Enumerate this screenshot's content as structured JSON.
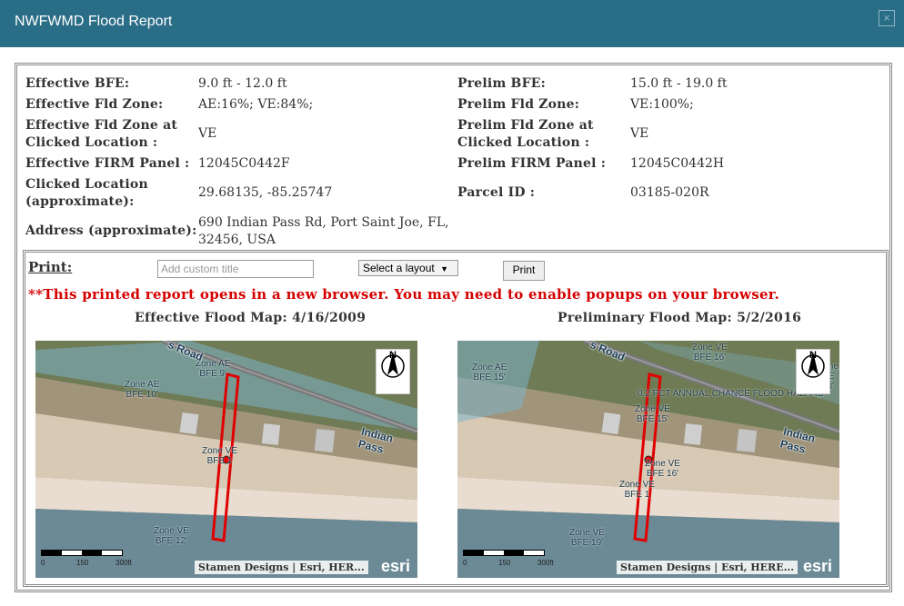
{
  "window": {
    "title": "NWFWMD Flood Report",
    "close_glyph": "×"
  },
  "effective": {
    "bfe_label": "Effective BFE:",
    "bfe": "9.0  ft  -  12.0  ft",
    "zone_label": "Effective Fld Zone:",
    "zone": "AE:16%;  VE:84%;",
    "clicked_zone_label_1": "Effective Fld Zone at",
    "clicked_zone_label_2": "Clicked Location :",
    "clicked_zone": "VE",
    "panel_label": "Effective FIRM Panel :",
    "panel": "12045C0442F"
  },
  "prelim": {
    "bfe_label": "Prelim BFE:",
    "bfe": "15.0  ft  -  19.0  ft",
    "zone_label": "Prelim Fld Zone:",
    "zone": "VE:100%;",
    "clicked_zone_label_1": "Prelim Fld Zone at",
    "clicked_zone_label_2": "Clicked Location :",
    "clicked_zone": "VE",
    "panel_label": "Prelim FIRM Panel :",
    "panel": "12045C0442H"
  },
  "location": {
    "clicked_label_1": "Clicked Location",
    "clicked_label_2": "(approximate):",
    "clicked": "29.68135,  -85.25747",
    "parcel_label": "Parcel ID :",
    "parcel": "03185-020R",
    "address_label": "Address (approximate):",
    "address_1": "690  Indian  Pass  Rd,  Port  Saint  Joe,  FL,",
    "address_2": "32456,  USA"
  },
  "print": {
    "label": "Print:",
    "title_placeholder": "Add custom title",
    "layout_label": "Select a layout",
    "layout_arrow": "▼",
    "button": "Print",
    "warning": "**This printed report opens in a new browser. You may need to enable popups on your browser."
  },
  "maps": [
    {
      "title": "Effective Flood Map: 4/16/2009",
      "road": "s Road",
      "road2": "Indian Pass",
      "zones": [
        {
          "l1": "Zone AE",
          "l2": "BFE 9'"
        },
        {
          "l1": "Zone AE",
          "l2": "BFE 10'"
        },
        {
          "l1": "Zone VE",
          "l2": "BFE 1"
        },
        {
          "l1": "Zone VE",
          "l2": "BFE 12'"
        }
      ],
      "north": "N",
      "scale": [
        "0",
        "150",
        "300ft"
      ],
      "attribution": "Stamen Designs  |  Esri,  HER...",
      "logo": "esri"
    },
    {
      "title": "Preliminary Flood Map: 5/2/2016",
      "road": "s Road",
      "road2": "Indian Pass",
      "zones": [
        {
          "l1": "Zone AE",
          "l2": "BFE 15'"
        },
        {
          "l1": "Zone VE",
          "l2": "BFE 16'"
        },
        {
          "l1": "Zone VE",
          "l2": "BFE 15'"
        },
        {
          "l1": "Zone VE",
          "l2": "BFE 16'"
        },
        {
          "l1": "Zone VE",
          "l2": "BFE 1"
        },
        {
          "l1": "Zone VE",
          "l2": "BFE 19'"
        },
        {
          "l1": "Zone AE",
          "l2": "13'"
        }
      ],
      "flood_note": "0.2 PCT ANNUAL CHANCE FLOOD HAZARD",
      "north": "N",
      "scale": [
        "0",
        "150",
        "300ft"
      ],
      "attribution": "Stamen  Designs  |  Esri,  HERE...",
      "logo": "esri"
    }
  ],
  "colors": {
    "titlebar": "#2a6d86",
    "warning": "#d40000",
    "parcel_outline": "#e00000",
    "flood_zone": "#7fb3c8"
  }
}
